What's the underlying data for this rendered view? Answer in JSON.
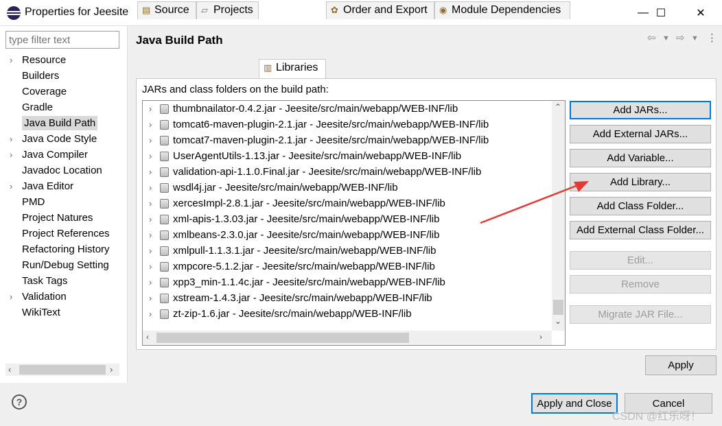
{
  "window": {
    "title": "Properties for Jeesite",
    "minimize": "—",
    "maximize": "☐",
    "close": "✕"
  },
  "filter": {
    "placeholder": "type filter text"
  },
  "tree": [
    {
      "label": "Resource",
      "expandable": true
    },
    {
      "label": "Builders",
      "expandable": false
    },
    {
      "label": "Coverage",
      "expandable": false
    },
    {
      "label": "Gradle",
      "expandable": false
    },
    {
      "label": "Java Build Path",
      "expandable": false,
      "selected": true
    },
    {
      "label": "Java Code Style",
      "expandable": true
    },
    {
      "label": "Java Compiler",
      "expandable": true
    },
    {
      "label": "Javadoc Location",
      "expandable": false
    },
    {
      "label": "Java Editor",
      "expandable": true
    },
    {
      "label": "PMD",
      "expandable": false
    },
    {
      "label": "Project Natures",
      "expandable": false
    },
    {
      "label": "Project References",
      "expandable": false
    },
    {
      "label": "Refactoring History",
      "expandable": false
    },
    {
      "label": "Run/Debug Setting",
      "expandable": false
    },
    {
      "label": "Task Tags",
      "expandable": false
    },
    {
      "label": "Validation",
      "expandable": true
    },
    {
      "label": "WikiText",
      "expandable": false
    }
  ],
  "page": {
    "title": "Java Build Path"
  },
  "tabs": [
    {
      "label": "Source",
      "icon": "source-folder-icon"
    },
    {
      "label": "Projects",
      "icon": "projects-icon"
    },
    {
      "label": "Libraries",
      "icon": "libraries-icon",
      "active": true
    },
    {
      "label": "Order and Export",
      "icon": "order-export-icon"
    },
    {
      "label": "Module Dependencies",
      "icon": "module-icon"
    }
  ],
  "libraries": {
    "label": "JARs and class folders on the build path:",
    "items": [
      "thumbnailator-0.4.2.jar - Jeesite/src/main/webapp/WEB-INF/lib",
      "tomcat6-maven-plugin-2.1.jar - Jeesite/src/main/webapp/WEB-INF/lib",
      "tomcat7-maven-plugin-2.1.jar - Jeesite/src/main/webapp/WEB-INF/lib",
      "UserAgentUtils-1.13.jar - Jeesite/src/main/webapp/WEB-INF/lib",
      "validation-api-1.1.0.Final.jar - Jeesite/src/main/webapp/WEB-INF/lib",
      "wsdl4j.jar - Jeesite/src/main/webapp/WEB-INF/lib",
      "xercesImpl-2.8.1.jar - Jeesite/src/main/webapp/WEB-INF/lib",
      "xml-apis-1.3.03.jar - Jeesite/src/main/webapp/WEB-INF/lib",
      "xmlbeans-2.3.0.jar - Jeesite/src/main/webapp/WEB-INF/lib",
      "xmlpull-1.1.3.1.jar - Jeesite/src/main/webapp/WEB-INF/lib",
      "xmpcore-5.1.2.jar - Jeesite/src/main/webapp/WEB-INF/lib",
      "xpp3_min-1.1.4c.jar - Jeesite/src/main/webapp/WEB-INF/lib",
      "xstream-1.4.3.jar - Jeesite/src/main/webapp/WEB-INF/lib",
      "zt-zip-1.6.jar - Jeesite/src/main/webapp/WEB-INF/lib"
    ]
  },
  "buttons": {
    "add_jars": "Add JARs...",
    "add_external_jars": "Add External JARs...",
    "add_variable": "Add Variable...",
    "add_library": "Add Library...",
    "add_class_folder": "Add Class Folder...",
    "add_external_class_folder": "Add External Class Folder...",
    "edit": "Edit...",
    "remove": "Remove",
    "migrate_jar": "Migrate JAR File...",
    "apply": "Apply",
    "apply_and_close": "Apply and Close",
    "cancel": "Cancel"
  },
  "watermark": "CSDN @红乐呀！",
  "colors": {
    "annotation_arrow": "#e53935",
    "default_button_border": "#0078d7"
  }
}
